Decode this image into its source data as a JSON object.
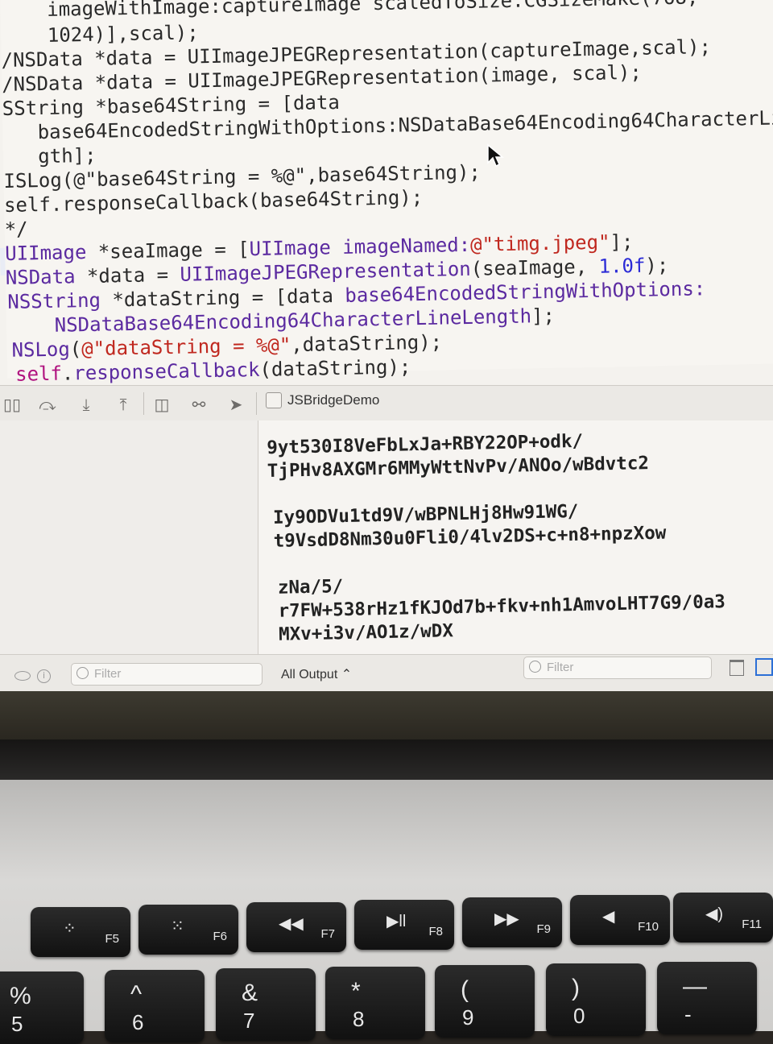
{
  "editor": {
    "lines": [
      [
        {
          "t": "    imageWithImage:captureImage scaledToSize:CGSizeMake(768,",
          "c": "plain"
        }
      ],
      [
        {
          "t": "    1024)],scal);",
          "c": "plain"
        }
      ],
      [
        {
          "t": "/NSData *data = UIImageJPEGRepresentation(captureImage,scal);",
          "c": "plain"
        }
      ],
      [
        {
          "t": "/NSData *data = UIImageJPEGRepresentation(image, scal);",
          "c": "plain"
        }
      ],
      [
        {
          "t": "SString *base64String = [data",
          "c": "plain"
        }
      ],
      [
        {
          "t": "   base64EncodedStringWithOptions:NSDataBase64Encoding64CharacterLi",
          "c": "plain"
        }
      ],
      [
        {
          "t": "   gth];",
          "c": "plain"
        }
      ],
      [
        {
          "t": "ISLog(@\"base64String = %@\",base64String);",
          "c": "plain"
        }
      ],
      [
        {
          "t": "self.responseCallback(base64String);",
          "c": "plain"
        }
      ],
      [
        {
          "t": "*/",
          "c": "plain"
        }
      ],
      [
        {
          "t": "UIImage",
          "c": "class"
        },
        {
          "t": " *seaImage = [",
          "c": "plain"
        },
        {
          "t": "UIImage",
          "c": "class"
        },
        {
          "t": " imageNamed:",
          "c": "class"
        },
        {
          "t": "@\"timg.jpeg\"",
          "c": "str"
        },
        {
          "t": "];",
          "c": "plain"
        }
      ],
      [
        {
          "t": "NSData",
          "c": "class"
        },
        {
          "t": " *data = ",
          "c": "plain"
        },
        {
          "t": "UIImageJPEGRepresentation",
          "c": "class"
        },
        {
          "t": "(seaImage, ",
          "c": "plain"
        },
        {
          "t": "1.0f",
          "c": "num"
        },
        {
          "t": ");",
          "c": "plain"
        }
      ],
      [
        {
          "t": "NSString",
          "c": "class"
        },
        {
          "t": " *dataString = [data ",
          "c": "plain"
        },
        {
          "t": "base64EncodedStringWithOptions:",
          "c": "class"
        }
      ],
      [
        {
          "t": "    NSDataBase64Encoding64CharacterLineLength",
          "c": "class"
        },
        {
          "t": "];",
          "c": "plain"
        }
      ],
      [
        {
          "t": "NSLog",
          "c": "class"
        },
        {
          "t": "(",
          "c": "plain"
        },
        {
          "t": "@\"dataString = %@\"",
          "c": "str"
        },
        {
          "t": ",dataString);",
          "c": "plain"
        }
      ],
      [
        {
          "t": "self",
          "c": "kw"
        },
        {
          "t": ".",
          "c": "plain"
        },
        {
          "t": "responseCallback",
          "c": "class"
        },
        {
          "t": "(dataString);",
          "c": "plain"
        }
      ]
    ]
  },
  "debug_bar": {
    "target_name": "JSBridgeDemo",
    "icons": [
      "hide-debug-area-icon",
      "step-over-icon",
      "step-into-icon",
      "step-out-icon",
      "debug-view-hierarchy-icon",
      "memory-graph-icon",
      "simulate-location-icon"
    ]
  },
  "console": {
    "lines": [
      "9yt530I8VeFbLxJa+RBY22OP+odk/",
      "TjPHv8AXGMr6MMyWttNvPv/ANOo/wBdvtc2",
      "",
      "Iy9ODVu1td9V/wBPNLHj8Hw91WG/",
      "t9VsdD8Nm30u0Fli0/4lv2DS+c+n8+npzXow",
      "",
      "zNa/5/",
      "r7FW+538rHz1fKJOd7b+fkv+nh1AmvoLHT7G9/0a3",
      "MXv+i3v/AO1z/wDX"
    ]
  },
  "filter_bar": {
    "variables_filter_placeholder": "Filter",
    "output_selector": "All Output",
    "console_filter_placeholder": "Filter"
  },
  "keyboard": {
    "fn_keys": [
      {
        "label": "F5",
        "glyph": "⁘"
      },
      {
        "label": "F6",
        "glyph": "⁙"
      },
      {
        "label": "F7",
        "glyph": "◀◀"
      },
      {
        "label": "F8",
        "glyph": "▶ll"
      },
      {
        "label": "F9",
        "glyph": "▶▶"
      },
      {
        "label": "F10",
        "glyph": "◀"
      },
      {
        "label": "F11",
        "glyph": "◀)"
      }
    ],
    "number_keys": [
      {
        "top": "%",
        "bottom": "5"
      },
      {
        "top": "^",
        "bottom": "6"
      },
      {
        "top": "&",
        "bottom": "7"
      },
      {
        "top": "*",
        "bottom": "8"
      },
      {
        "top": "(",
        "bottom": "9"
      },
      {
        "top": ")",
        "bottom": "0"
      },
      {
        "top": "—",
        "bottom": "-"
      }
    ]
  },
  "colors": {
    "type_purple": "#5b2aa0",
    "string_red": "#c0281f",
    "number_blue": "#2b2bd6",
    "keyword_magenta": "#b0137f"
  }
}
